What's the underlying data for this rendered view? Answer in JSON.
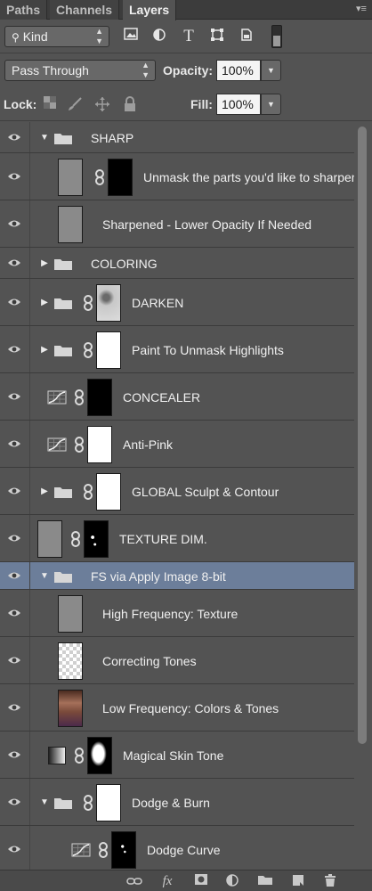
{
  "tabs": [
    {
      "label": "Paths"
    },
    {
      "label": "Channels"
    },
    {
      "label": "Layers"
    }
  ],
  "filter": {
    "kind_label": "Kind"
  },
  "blend": {
    "mode": "Pass Through",
    "opacity_label": "Opacity:",
    "opacity_value": "100%"
  },
  "lock": {
    "lock_label": "Lock:",
    "fill_label": "Fill:",
    "fill_value": "100%"
  },
  "layers": [
    {
      "name": "SHARP",
      "type": "group",
      "expanded": true,
      "indent": 0,
      "chain": false,
      "thumb": "",
      "mask": ""
    },
    {
      "name": "Unmask the parts you'd like to sharpen",
      "type": "pixel",
      "indent": 1,
      "chain": true,
      "thumb": "gray",
      "mask": "black"
    },
    {
      "name": "Sharpened - Lower Opacity If Needed",
      "type": "pixel",
      "indent": 1,
      "chain": false,
      "thumb": "gray",
      "mask": ""
    },
    {
      "name": "COLORING",
      "type": "group",
      "expanded": false,
      "indent": 0,
      "chain": false,
      "thumb": "",
      "mask": ""
    },
    {
      "name": "DARKEN",
      "type": "group",
      "expanded": false,
      "indent": 0,
      "chain": true,
      "thumb": "",
      "mask": "darken"
    },
    {
      "name": "Paint To Unmask Highlights",
      "type": "group",
      "expanded": false,
      "indent": 0,
      "chain": true,
      "thumb": "",
      "mask": "white"
    },
    {
      "name": "CONCEALER",
      "type": "curves",
      "indent": 0,
      "chain": true,
      "thumb": "",
      "mask": "black"
    },
    {
      "name": "Anti-Pink",
      "type": "curves",
      "indent": 0,
      "chain": true,
      "thumb": "",
      "mask": "white"
    },
    {
      "name": "GLOBAL Sculpt & Contour",
      "type": "group",
      "expanded": false,
      "indent": 0,
      "chain": true,
      "thumb": "",
      "mask": "white"
    },
    {
      "name": "TEXTURE DIM.",
      "type": "pixel",
      "indent": 0,
      "chain": true,
      "thumb": "gray",
      "mask": "mask1"
    },
    {
      "name": "FS via Apply Image 8-bit",
      "type": "group",
      "expanded": true,
      "indent": 0,
      "chain": false,
      "thumb": "",
      "mask": "",
      "selected": true
    },
    {
      "name": "High Frequency: Texture",
      "type": "pixel",
      "indent": 1,
      "chain": false,
      "thumb": "gray",
      "mask": ""
    },
    {
      "name": "Correcting Tones",
      "type": "pixel",
      "indent": 1,
      "chain": false,
      "thumb": "check",
      "mask": ""
    },
    {
      "name": "Low Frequency: Colors & Tones",
      "type": "pixel",
      "indent": 1,
      "chain": false,
      "thumb": "photo",
      "mask": ""
    },
    {
      "name": "Magical Skin Tone",
      "type": "gradientmap",
      "indent": 0,
      "chain": true,
      "thumb": "",
      "mask": "skinmask"
    },
    {
      "name": "Dodge & Burn",
      "type": "group",
      "expanded": true,
      "indent": 0,
      "chain": true,
      "thumb": "",
      "mask": "white"
    },
    {
      "name": "Dodge Curve",
      "type": "curves",
      "indent": 1,
      "chain": true,
      "thumb": "",
      "mask": "dodgemask"
    }
  ],
  "icons": {
    "eye": "eye-icon",
    "folder": "folder-icon",
    "chain": "chain-link-icon",
    "curves": "curves-adjustment-icon",
    "gradientmap": "gradient-map-icon"
  },
  "colors": {
    "panel": "#535353",
    "selected_row": "#6c7e9a",
    "tab_bar": "#3c3c3c"
  }
}
